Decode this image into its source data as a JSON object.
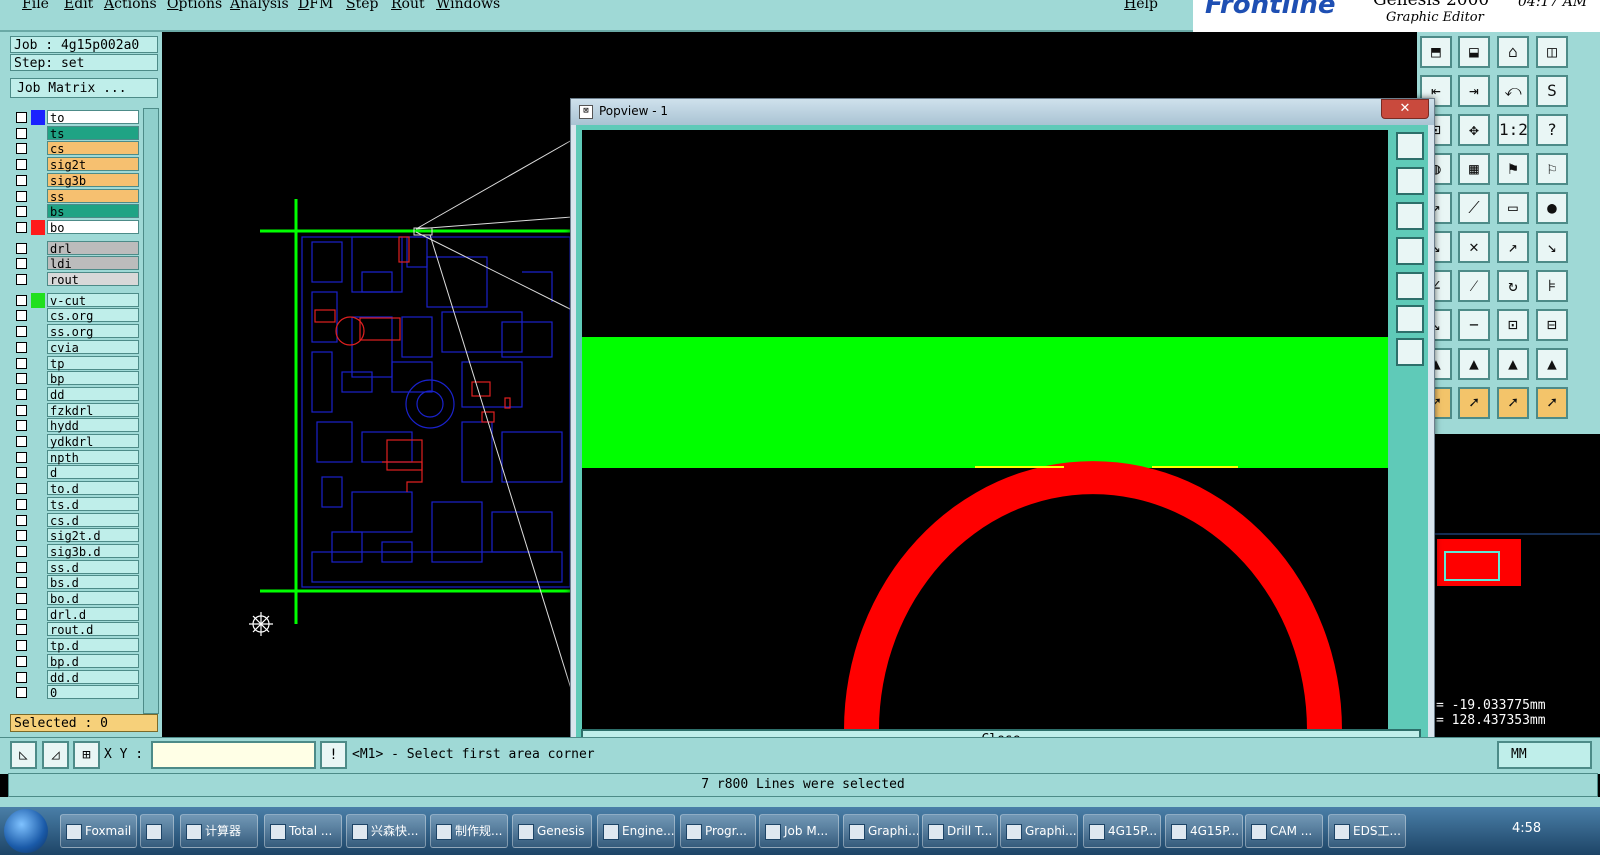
{
  "menu": {
    "items": [
      "File",
      "Edit",
      "Actions",
      "Options",
      "Analysis",
      "DFM",
      "Step",
      "Rout",
      "Windows"
    ],
    "help": "Help"
  },
  "brand": {
    "name": "Frontline",
    "product": "Genesis 2000",
    "subtitle": "Graphic Editor",
    "time": "04:17 AM"
  },
  "job": {
    "job_label": "Job : 4g15p002a0",
    "step_label": "Step: set",
    "matrix_button": "Job Matrix ..."
  },
  "layers": [
    {
      "name": "to",
      "color": "#ffffff",
      "swatch": "#1a22ff"
    },
    {
      "name": "ts",
      "color": "#1fa384",
      "swatch": ""
    },
    {
      "name": "cs",
      "color": "#f6c070",
      "swatch": ""
    },
    {
      "name": "sig2t",
      "color": "#f6c070",
      "swatch": ""
    },
    {
      "name": "sig3b",
      "color": "#f6c070",
      "swatch": ""
    },
    {
      "name": "ss",
      "color": "#f6c070",
      "swatch": ""
    },
    {
      "name": "bs",
      "color": "#1fa384",
      "swatch": ""
    },
    {
      "name": "bo",
      "color": "#ffffff",
      "swatch": "#ff1a1a"
    },
    {
      "name": "drl",
      "color": "#bcbcbc",
      "swatch": ""
    },
    {
      "name": "ldi",
      "color": "#bcbcbc",
      "swatch": ""
    },
    {
      "name": "rout",
      "color": "#d8d8d8",
      "swatch": ""
    },
    {
      "name": "v-cut",
      "color": "#bfeeea",
      "swatch": "#21e01e"
    },
    {
      "name": "cs.org",
      "color": "#bfeeea",
      "swatch": ""
    },
    {
      "name": "ss.org",
      "color": "#bfeeea",
      "swatch": ""
    },
    {
      "name": "cvia",
      "color": "#bfeeea",
      "swatch": ""
    },
    {
      "name": "tp",
      "color": "#bfeeea",
      "swatch": ""
    },
    {
      "name": "bp",
      "color": "#bfeeea",
      "swatch": ""
    },
    {
      "name": "dd",
      "color": "#bfeeea",
      "swatch": ""
    },
    {
      "name": "fzkdrl",
      "color": "#bfeeea",
      "swatch": ""
    },
    {
      "name": "hydd",
      "color": "#bfeeea",
      "swatch": ""
    },
    {
      "name": "ydkdrl",
      "color": "#bfeeea",
      "swatch": ""
    },
    {
      "name": "npth",
      "color": "#bfeeea",
      "swatch": ""
    },
    {
      "name": "d",
      "color": "#bfeeea",
      "swatch": ""
    },
    {
      "name": "to.d",
      "color": "#bfeeea",
      "swatch": ""
    },
    {
      "name": "ts.d",
      "color": "#bfeeea",
      "swatch": ""
    },
    {
      "name": "cs.d",
      "color": "#bfeeea",
      "swatch": ""
    },
    {
      "name": "sig2t.d",
      "color": "#bfeeea",
      "swatch": ""
    },
    {
      "name": "sig3b.d",
      "color": "#bfeeea",
      "swatch": ""
    },
    {
      "name": "ss.d",
      "color": "#bfeeea",
      "swatch": ""
    },
    {
      "name": "bs.d",
      "color": "#bfeeea",
      "swatch": ""
    },
    {
      "name": "bo.d",
      "color": "#bfeeea",
      "swatch": ""
    },
    {
      "name": "drl.d",
      "color": "#bfeeea",
      "swatch": ""
    },
    {
      "name": "rout.d",
      "color": "#bfeeea",
      "swatch": ""
    },
    {
      "name": "tp.d",
      "color": "#bfeeea",
      "swatch": ""
    },
    {
      "name": "bp.d",
      "color": "#bfeeea",
      "swatch": ""
    },
    {
      "name": "dd.d",
      "color": "#bfeeea",
      "swatch": ""
    },
    {
      "name": "0",
      "color": "#bfeeea",
      "swatch": ""
    }
  ],
  "selected_label": "Selected : 0",
  "popview": {
    "title": "Popview - 1",
    "close_x": "✕",
    "close_button": "Close"
  },
  "coords": {
    "x": "= -19.033775mm",
    "y": "= 128.437353mm"
  },
  "command": {
    "xy_label": "X Y :",
    "xy_value": "",
    "prompt": "<M1> - Select first area corner",
    "units": "MM"
  },
  "status": "7 r800 Lines were selected",
  "taskbar": {
    "items": [
      "Foxmail",
      "",
      "计算器",
      "Total ...",
      "兴森快...",
      "制作规...",
      "Genesis",
      "Engine...",
      "Progr...",
      "Job M...",
      "Graphi...",
      "Drill T...",
      "Graphi...",
      "4G15P...",
      "4G15P...",
      "CAM ...",
      "EDS工..."
    ],
    "clock": "4:58"
  },
  "colors": {
    "panel": "#9fd9d6",
    "vcut_green": "#00ff00",
    "outline_red": "#ff0000",
    "trace_blue": "#1a22cc"
  }
}
